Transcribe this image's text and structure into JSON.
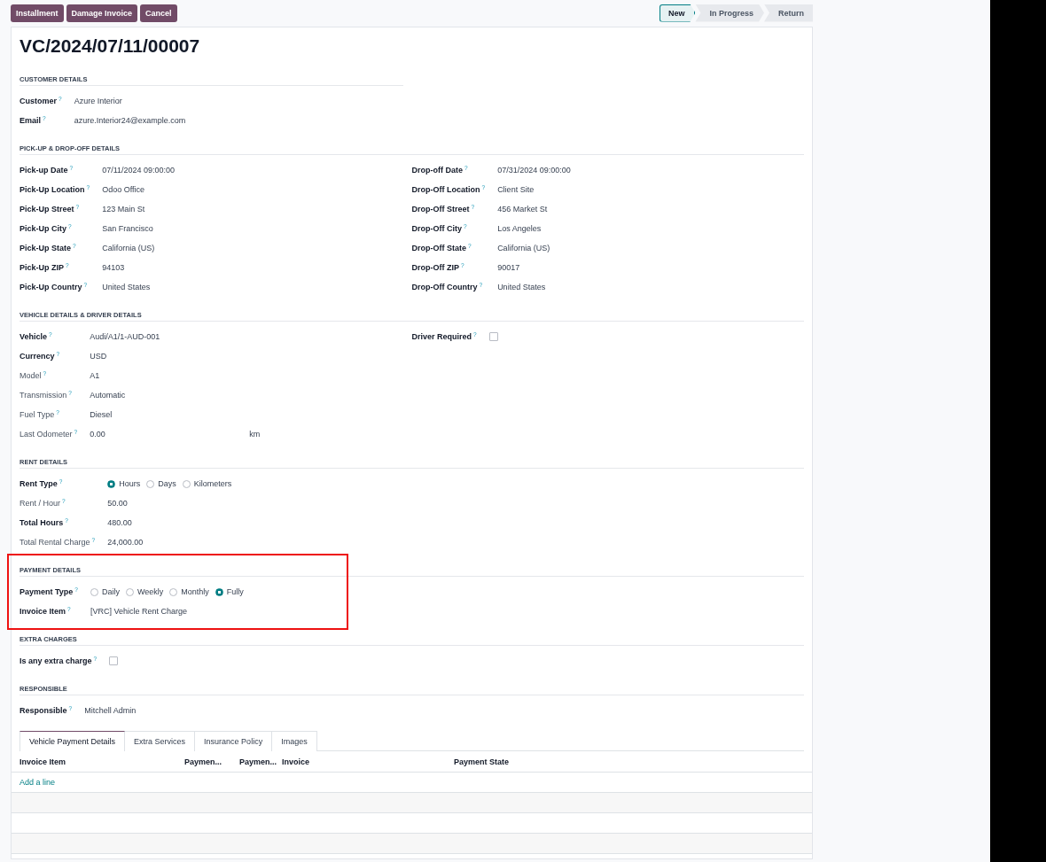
{
  "action_buttons": [
    "Installment",
    "Damage Invoice",
    "Cancel"
  ],
  "status_steps": [
    {
      "label": "New",
      "selected": true
    },
    {
      "label": "In Progress",
      "selected": false
    },
    {
      "label": "Return",
      "selected": false
    }
  ],
  "record_title": "VC/2024/07/11/00007",
  "sections": [
    {
      "title": "CUSTOMER DETAILS",
      "kind": "half",
      "highlighted": false,
      "columns": [
        [
          {
            "label": "Customer",
            "help": "?",
            "bold": true,
            "kind": "text",
            "value": "Azure Interior"
          },
          {
            "label": "Email",
            "help": "?",
            "bold": true,
            "kind": "text",
            "value": "azure.Interior24@example.com"
          }
        ]
      ]
    },
    {
      "title": "PICK-UP & DROP-OFF DETAILS",
      "kind": "split",
      "highlighted": false,
      "columns": [
        [
          {
            "label": "Pick-up Date",
            "help": "?",
            "bold": true,
            "kind": "text",
            "value": "07/11/2024 09:00:00"
          },
          {
            "label": "Pick-Up Location",
            "help": "?",
            "bold": true,
            "kind": "text",
            "value": "Odoo Office"
          },
          {
            "label": "Pick-Up Street",
            "help": "?",
            "bold": true,
            "kind": "text",
            "value": "123 Main St"
          },
          {
            "label": "Pick-Up City",
            "help": "?",
            "bold": true,
            "kind": "text",
            "value": "San Francisco"
          },
          {
            "label": "Pick-Up State",
            "help": "?",
            "bold": true,
            "kind": "text",
            "value": "California (US)"
          },
          {
            "label": "Pick-Up ZIP",
            "help": "?",
            "bold": true,
            "kind": "text",
            "value": "94103"
          },
          {
            "label": "Pick-Up Country",
            "help": "?",
            "bold": true,
            "kind": "text",
            "value": "United States"
          }
        ],
        [
          {
            "label": "Drop-off Date",
            "help": "?",
            "bold": true,
            "kind": "text",
            "value": "07/31/2024 09:00:00"
          },
          {
            "label": "Drop-Off Location",
            "help": "?",
            "bold": true,
            "kind": "text",
            "value": "Client Site"
          },
          {
            "label": "Drop-Off Street",
            "help": "?",
            "bold": true,
            "kind": "text",
            "value": "456 Market St"
          },
          {
            "label": "Drop-Off City",
            "help": "?",
            "bold": true,
            "kind": "text",
            "value": "Los Angeles"
          },
          {
            "label": "Drop-Off State",
            "help": "?",
            "bold": true,
            "kind": "text",
            "value": "California (US)"
          },
          {
            "label": "Drop-Off ZIP",
            "help": "?",
            "bold": true,
            "kind": "text",
            "value": "90017"
          },
          {
            "label": "Drop-Off Country",
            "help": "?",
            "bold": true,
            "kind": "text",
            "value": "United States"
          }
        ]
      ]
    },
    {
      "title": "VEHICLE DETAILS & DRIVER DETAILS",
      "kind": "split",
      "highlighted": false,
      "columns": [
        [
          {
            "label": "Vehicle",
            "help": "?",
            "bold": true,
            "kind": "text",
            "value": "Audi/A1/1-AUD-001"
          },
          {
            "label": "Currency",
            "help": "?",
            "bold": true,
            "kind": "text",
            "value": "USD"
          },
          {
            "label": "Model",
            "help": "?",
            "bold": false,
            "kind": "text",
            "value": "A1"
          },
          {
            "label": "Transmission",
            "help": "?",
            "bold": false,
            "kind": "text",
            "value": "Automatic"
          },
          {
            "label": "Fuel Type",
            "help": "?",
            "bold": false,
            "kind": "text",
            "value": "Diesel"
          },
          {
            "label": "Last Odometer",
            "help": "?",
            "bold": false,
            "kind": "measure",
            "value": "0.00",
            "unit": "km"
          }
        ],
        [
          {
            "label": "Driver Required",
            "help": "?",
            "bold": true,
            "kind": "checkbox",
            "checked": false
          }
        ]
      ]
    },
    {
      "title": "RENT DETAILS",
      "kind": "full",
      "highlighted": false,
      "columns": [
        [
          {
            "label": "Rent Type",
            "help": "?",
            "bold": true,
            "kind": "radio",
            "options": [
              {
                "label": "Hours",
                "selected": true
              },
              {
                "label": "Days",
                "selected": false
              },
              {
                "label": "Kilometers",
                "selected": false
              }
            ]
          },
          {
            "label": "Rent / Hour",
            "help": "?",
            "bold": false,
            "kind": "text",
            "value": "50.00"
          },
          {
            "label": "Total Hours",
            "help": "?",
            "bold": true,
            "kind": "text",
            "value": "480.00"
          },
          {
            "label": "Total Rental Charge",
            "help": "?",
            "bold": false,
            "kind": "text",
            "value": "24,000.00"
          }
        ]
      ]
    },
    {
      "title": "PAYMENT DETAILS",
      "kind": "full",
      "highlighted": true,
      "columns": [
        [
          {
            "label": "Payment Type",
            "help": "?",
            "bold": true,
            "kind": "radio",
            "options": [
              {
                "label": "Daily",
                "selected": false
              },
              {
                "label": "Weekly",
                "selected": false
              },
              {
                "label": "Monthly",
                "selected": false
              },
              {
                "label": "Fully",
                "selected": true
              }
            ]
          },
          {
            "label": "Invoice Item",
            "help": "?",
            "bold": true,
            "kind": "text",
            "value": "[VRC] Vehicle Rent Charge"
          }
        ]
      ]
    },
    {
      "title": "EXTRA CHARGES",
      "kind": "full",
      "highlighted": false,
      "columns": [
        [
          {
            "label": "Is any extra charge",
            "help": "?",
            "bold": true,
            "kind": "checkbox",
            "checked": false
          }
        ]
      ]
    },
    {
      "title": "RESPONSIBLE",
      "kind": "full",
      "highlighted": false,
      "columns": [
        [
          {
            "label": "Responsible",
            "help": "?",
            "bold": true,
            "kind": "text",
            "value": "Mitchell Admin"
          }
        ]
      ]
    }
  ],
  "tabs": [
    {
      "label": "Vehicle Payment Details",
      "selected": true
    },
    {
      "label": "Extra Services",
      "selected": false
    },
    {
      "label": "Insurance Policy",
      "selected": false
    },
    {
      "label": "Images",
      "selected": false
    }
  ],
  "table": {
    "columns": [
      "Invoice Item",
      "Paymen...",
      "Paymen...",
      "Invoice",
      "Payment State"
    ],
    "add_line": "Add a line"
  }
}
